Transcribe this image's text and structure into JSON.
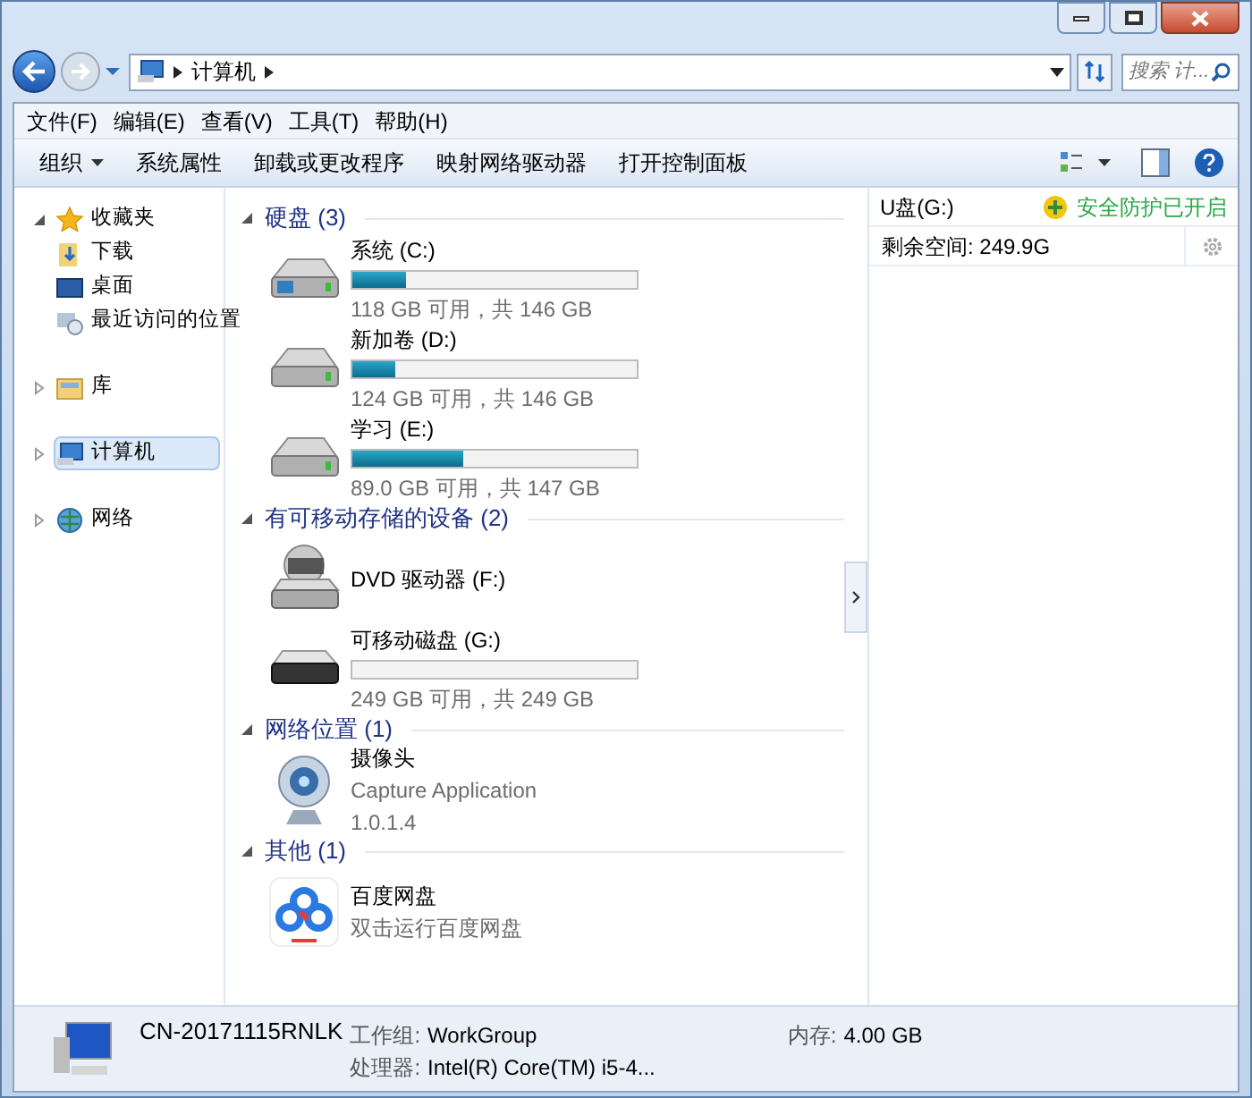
{
  "address": {
    "path": "计算机"
  },
  "search": {
    "placeholder": "搜索 计..."
  },
  "menu": [
    "文件(F)",
    "编辑(E)",
    "查看(V)",
    "工具(T)",
    "帮助(H)"
  ],
  "toolbar": [
    {
      "label": "组织",
      "dropdown": true
    },
    {
      "label": "系统属性",
      "dropdown": false
    },
    {
      "label": "卸载或更改程序",
      "dropdown": false
    },
    {
      "label": "映射网络驱动器",
      "dropdown": false
    },
    {
      "label": "打开控制面板",
      "dropdown": false
    }
  ],
  "sidebar": {
    "items": [
      {
        "kind": "favorites",
        "label": "收藏夹",
        "selected": false,
        "expanded": true,
        "children": [
          {
            "kind": "downloads",
            "label": "下载",
            "selected": false
          },
          {
            "kind": "desktop",
            "label": "桌面",
            "selected": false
          },
          {
            "kind": "recent",
            "label": "最近访问的位置",
            "selected": false
          }
        ]
      },
      {
        "kind": "libraries",
        "label": "库",
        "selected": false,
        "expanded": false
      },
      {
        "kind": "computer",
        "label": "计算机",
        "selected": true,
        "expanded": false
      },
      {
        "kind": "network",
        "label": "网络",
        "selected": false,
        "expanded": false
      }
    ]
  },
  "groups": [
    {
      "title": "硬盘 (3)",
      "expanded": true,
      "items": [
        {
          "kind": "drive",
          "system": true,
          "name": "系统 (C:)",
          "level": 0.19,
          "detail": "118 GB 可用，共 146 GB"
        },
        {
          "kind": "drive",
          "system": false,
          "name": "新加卷 (D:)",
          "level": 0.15,
          "detail": "124 GB 可用，共 146 GB"
        },
        {
          "kind": "drive",
          "system": false,
          "name": "学习 (E:)",
          "level": 0.39,
          "detail": "89.0 GB 可用，共 147 GB"
        }
      ]
    },
    {
      "title": "有可移动存储的设备 (2)",
      "expanded": true,
      "items": [
        {
          "kind": "optical",
          "name": "DVD 驱动器 (F:)"
        },
        {
          "kind": "removable",
          "name": "可移动磁盘 (G:)",
          "level": 0,
          "detail": "249 GB 可用，共 249 GB"
        }
      ]
    },
    {
      "title": "网络位置 (1)",
      "expanded": true,
      "items": [
        {
          "kind": "webcam",
          "name": "摄像头",
          "lines": [
            "Capture Application",
            "1.0.1.4"
          ]
        }
      ]
    },
    {
      "title": "其他 (1)",
      "expanded": true,
      "items": [
        {
          "kind": "cloud",
          "name": "百度网盘",
          "lines": [
            "双击运行百度网盘"
          ]
        }
      ]
    }
  ],
  "preview": {
    "title": "U盘(G:)",
    "status": "安全防护已开启",
    "free": "剩余空间: 249.9G"
  },
  "details": {
    "name": "CN-20171115RNLK",
    "fields": [
      {
        "label": "工作组:",
        "value": "WorkGroup"
      },
      {
        "label": "内存:",
        "value": "4.00 GB"
      },
      {
        "label": "处理器:",
        "value": "Intel(R) Core(TM) i5-4..."
      }
    ]
  }
}
